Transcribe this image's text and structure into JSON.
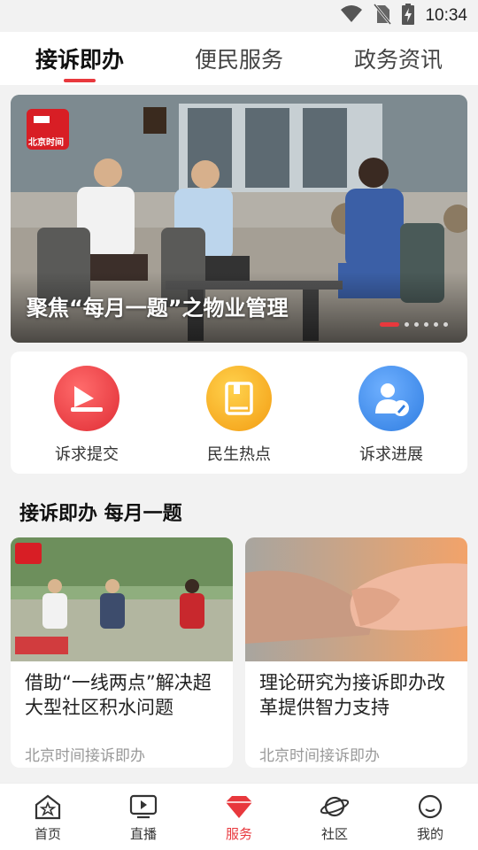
{
  "status_bar": {
    "time": "10:34",
    "icons": [
      "wifi-icon",
      "no-sim-icon",
      "battery-charging-icon"
    ]
  },
  "top_tabs": [
    {
      "label": "接诉即办",
      "active": true
    },
    {
      "label": "便民服务",
      "active": false
    },
    {
      "label": "政务资讯",
      "active": false
    }
  ],
  "banner": {
    "title": "聚焦“每月一题”之物业管理",
    "logo_text": "北京时间",
    "slide_count": 6,
    "current_slide": 1
  },
  "services": [
    {
      "label": "诉求提交",
      "icon": "submit-tray-icon",
      "color": "#e8383d"
    },
    {
      "label": "民生热点",
      "icon": "book-icon",
      "color": "#f5a623"
    },
    {
      "label": "诉求进展",
      "icon": "user-edit-icon",
      "color": "#3d8ef0"
    }
  ],
  "section": {
    "title": "接诉即办 每月一题"
  },
  "articles": [
    {
      "title": "借助“一线两点”解决超大型社区积水问题",
      "source": "北京时间接诉即办"
    },
    {
      "title": "理论研究为接诉即办改革提供智力支持",
      "source": "北京时间接诉即办"
    }
  ],
  "bottom_nav": [
    {
      "label": "首页",
      "icon": "home-icon",
      "active": false
    },
    {
      "label": "直播",
      "icon": "tv-play-icon",
      "active": false
    },
    {
      "label": "服务",
      "icon": "diamond-icon",
      "active": true
    },
    {
      "label": "社区",
      "icon": "planet-icon",
      "active": false
    },
    {
      "label": "我的",
      "icon": "profile-icon",
      "active": false
    }
  ],
  "colors": {
    "accent": "#e8383d",
    "background": "#f2f2f2"
  }
}
